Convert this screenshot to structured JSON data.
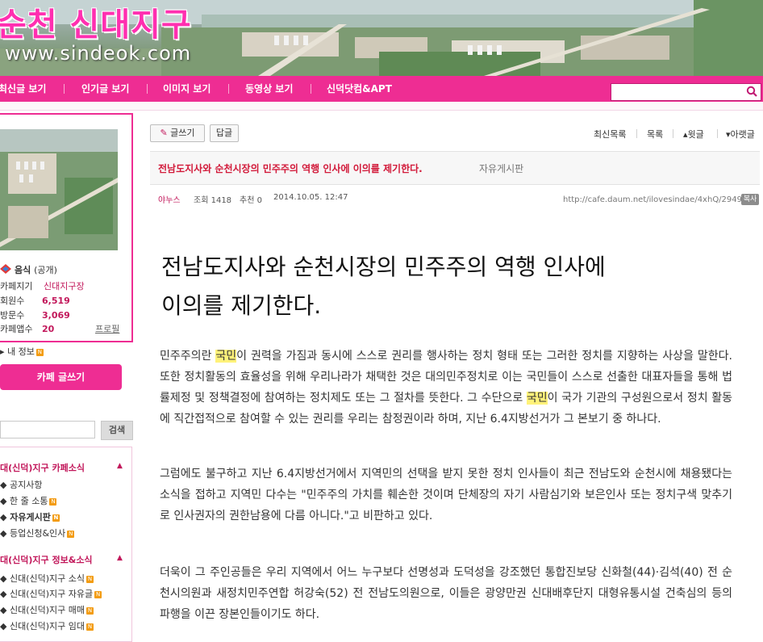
{
  "site": {
    "title": "순천 신대지구",
    "url": "www.sindeok.com"
  },
  "nav": {
    "items": [
      "최신글 보기",
      "인기글 보기",
      "이미지 보기",
      "동영상 보기",
      "신덕닷컴&APT"
    ],
    "search_placeholder": ""
  },
  "sidebar": {
    "cafe_name": "음식",
    "cafe_type": "(공개)",
    "manager_label": "카페지기",
    "manager_value": "신대지구장",
    "members_label": "회원수",
    "members_value": "6,519",
    "visitors_label": "방문수",
    "visitors_value": "3,069",
    "apps_label": "카페앱수",
    "apps_value": "20",
    "profile_link": "프로필",
    "my_info": "내 정보",
    "write_button": "카페 글쓰기",
    "search_button": "검색",
    "menu": {
      "group1_title": "대(신덕)지구 카페소식",
      "group1_items": [
        "공지사항",
        "한 줄 소통",
        "자유게시판",
        "등업신청&인사"
      ],
      "group2_title": "대(신덕)지구 정보&소식",
      "group2_items": [
        "신대(신덕)지구 소식",
        "신대(신덕)지구 자유글",
        "신대(신덕)지구 매매",
        "신대(신덕)지구 임대"
      ]
    },
    "new_badge": "N"
  },
  "toolbar": {
    "write_label": "글쓰기",
    "reply_label": "답글",
    "latest_label": "최신목록",
    "list_label": "목록",
    "prev_label": "▴윗글",
    "next_label": "▾아랫글"
  },
  "post": {
    "title": "전남도지사와 순천시장의 민주주의 역행 인사에 이의를 제기한다.",
    "category": "자유게시판",
    "author": "야누스",
    "views_label": "조회",
    "views_value": "1418",
    "recommend_label": "추천",
    "recommend_value": "0",
    "date": "2014.10.05. 12:47",
    "url": "http://cafe.daum.net/ilovesindae/4xhQ/2949",
    "copy_label": "복사",
    "headline_line1": "전남도지사와 순천시장의 민주주의 역행 인사에",
    "headline_line2": "이의를 제기한다.",
    "highlight_word": "국민",
    "p1_a": "민주주의란 ",
    "p1_b": "이 권력을 가짐과 동시에 스스로 권리를 행사하는 정치 형태 또는 그러한 정치를 지향하는 사상을 말한다. 또한  정치활동의 효율성을 위해 우리나라가 채택한 것은 대의민주정치로 이는 국민들이 스스로 선출한 대표자들을 통해 법률제정 및 정책결정에 참여하는 정치제도 또는 그 절차를 뜻한다. 그 수단으로 ",
    "p1_c": "이 국가 기관의 구성원으로서 정치 활동에 직간접적으로 참여할 수 있는 권리를 우리는 참정권이라 하며, 지난 6.4지방선거가 그 본보기 중 하나다.",
    "p2": "그럼에도 불구하고 지난 6.4지방선거에서 지역민의 선택을 받지 못한 정치 인사들이 최근 전남도와 순천시에 채용됐다는 소식을 접하고 지역민 다수는 \"민주주의 가치를 훼손한 것이며 단체장의 자기 사람심기와 보은인사 또는 정치구색 맞추기로 인사권자의 권한남용에 다름 아니다.\"고 비판하고 있다.",
    "p3": "더욱이 그 주인공들은 우리 지역에서 어느 누구보다 선명성과 도덕성을 강조했던 통합진보당 신화철(44)·김석(40) 전 순천시의원과 새정치민주연합 허강숙(52) 전 전남도의원으로, 이들은 광양만권 신대배후단지 대형유통시설 건축심의 등의 파행을 이끈 장본인들이기도 하다."
  },
  "colors": {
    "accent": "#ee2d93",
    "title_red": "#d21a3a",
    "highlight": "#fff27a"
  }
}
